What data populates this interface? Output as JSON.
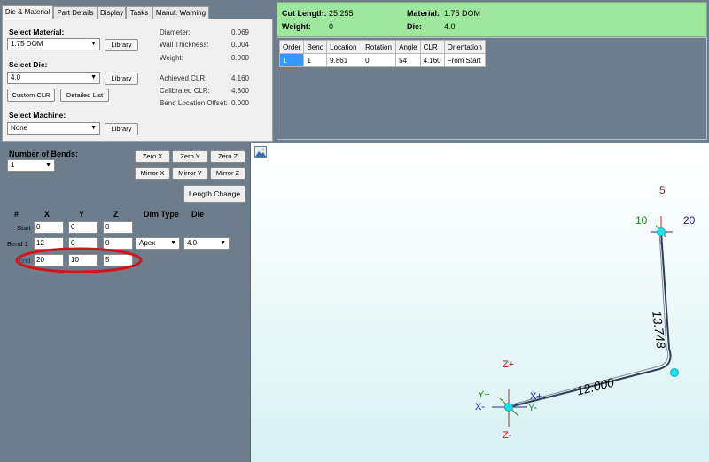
{
  "tabs": [
    "Die & Material",
    "Part Details",
    "Display",
    "Tasks",
    "Manuf. Warning"
  ],
  "material": {
    "select_material_label": "Select Material:",
    "material_value": "1.75 DOM",
    "library_label": "Library",
    "select_die_label": "Select Die:",
    "die_value": "4.0",
    "custom_clr_label": "Custom CLR",
    "detailed_list_label": "Detailed List",
    "select_machine_label": "Select Machine:",
    "machine_value": "None"
  },
  "info": {
    "diameter_label": "Diameter:",
    "diameter_value": "0.069",
    "wall_label": "Wall Thickness:",
    "wall_value": "0.004",
    "weight_label": "Weight:",
    "weight_value": "0.000",
    "achieved_label": "Achieved CLR:",
    "achieved_value": "4.160",
    "calibrated_label": "Calibrated CLR:",
    "calibrated_value": "4.800",
    "bend_offset_label": "Bend Location Offset:",
    "bend_offset_value": "0.000"
  },
  "summary": {
    "cut_length_label": "Cut Length:",
    "cut_length_value": "25.255",
    "weight_label": "Weight:",
    "weight_value": "0",
    "material_label": "Material:",
    "material_value": "1.75 DOM",
    "die_label": "Die:",
    "die_value": "4.0"
  },
  "bend_table": {
    "headers": [
      "Order",
      "Bend",
      "Location",
      "Rotation",
      "Angle",
      "CLR",
      "Orientation"
    ],
    "rows": [
      [
        "1",
        "1",
        "9.861",
        "0",
        "54",
        "4.160",
        "From Start"
      ]
    ]
  },
  "bends": {
    "number_label": "Number of Bends:",
    "number_value": "1",
    "zero_x": "Zero X",
    "zero_y": "Zero Y",
    "zero_z": "Zero Z",
    "mirror_x": "Mirror X",
    "mirror_y": "Mirror Y",
    "mirror_z": "Mirror Z",
    "length_change": "Length Change",
    "col_hash": "#",
    "col_x": "X",
    "col_y": "Y",
    "col_z": "Z",
    "col_dim": "Dim Type",
    "col_die": "Die",
    "start_label": "Start",
    "start": [
      "0",
      "0",
      "0"
    ],
    "bend1_label": "Bend 1",
    "bend1": [
      "12",
      "0",
      "0"
    ],
    "bend1_dim": "Apex",
    "bend1_die": "4.0",
    "end_label": "End",
    "end": [
      "20",
      "10",
      "5"
    ]
  },
  "view": {
    "top_z": "5",
    "top_y": "10",
    "top_x": "20",
    "len1": "13.748",
    "len2": "12.000",
    "axis_zp": "Z+",
    "axis_zm": "Z-",
    "axis_yp": "Y+",
    "axis_ym": "Y-",
    "axis_xp": "X+",
    "axis_xm": "X-"
  }
}
